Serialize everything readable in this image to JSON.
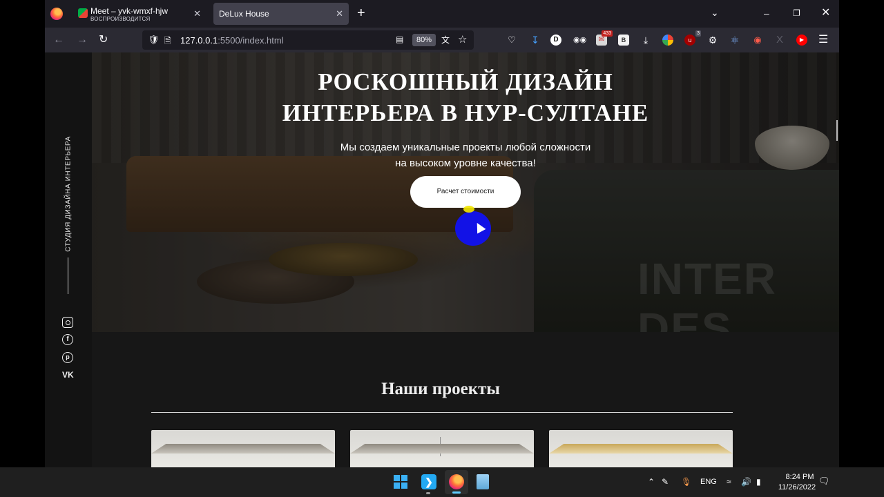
{
  "browser": {
    "tabs": [
      {
        "title": "Meet – yvk-wmxf-hjw",
        "subtitle": "ВОСПРОИЗВОДИТСЯ",
        "close": "✕"
      },
      {
        "title": "DeLux House",
        "close": "✕"
      }
    ],
    "new_tab": "+",
    "url_host": "127.0.0.1",
    "url_rest": ":5500/index.html",
    "zoom": "80%",
    "extensions": {
      "d_label": "D",
      "mail_badge": "433",
      "b_label": "B",
      "ublock_badge": "3",
      "x_label": "X"
    }
  },
  "page": {
    "sidebar": {
      "studio_label": "СТУДИЯ ДИЗАЙНА ИНТЕРЬЕРА",
      "vk_label": "VK"
    },
    "hero": {
      "title_line1": "РОСКОШНЫЙ ДИЗАЙН",
      "title_line2": "ИНТЕРЬЕРА В НУР-СУЛТАНЕ",
      "subtitle_line1": "Мы создаем уникальные проекты любой сложности",
      "subtitle_line2": "на высоком уровне качества!",
      "cta_label": "Расчет стоимости",
      "watermark_line1": "INTER",
      "watermark_line2": "DES"
    },
    "projects": {
      "title": "Наши проекты"
    }
  },
  "taskbar": {
    "lang": "ENG",
    "time": "8:24 PM",
    "date": "11/26/2022"
  },
  "colors": {
    "browser_bg": "#1c1b22",
    "toolbar_bg": "#2b2a33",
    "page_bg": "#171717",
    "cursor_halo": "#1212e6"
  }
}
